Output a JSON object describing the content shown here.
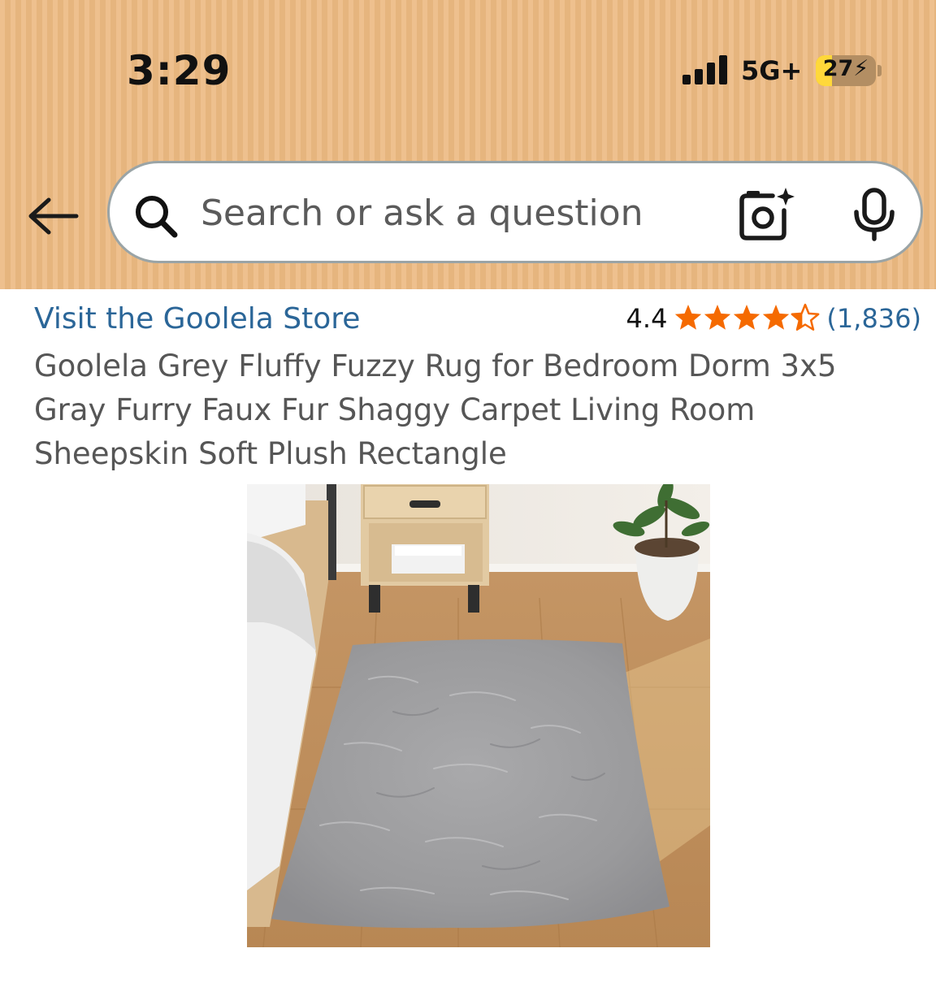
{
  "status_bar": {
    "time": "3:29",
    "network": "5G+",
    "battery_level": "27",
    "battery_fraction": 0.27,
    "signal_bars": 4
  },
  "header": {
    "background_color": "#ecb981",
    "back_icon": "arrow-left-icon",
    "search": {
      "placeholder": "Search or ask a question",
      "value": "",
      "left_icon": "search-icon",
      "camera_icon": "camera-sparkle-icon",
      "mic_icon": "microphone-icon"
    }
  },
  "product": {
    "store_link": "Visit the Goolela Store",
    "rating": {
      "value": "4.4",
      "stars": 4.4,
      "count": "(1,836)",
      "star_color": "#f56a00"
    },
    "title": "Goolela Grey Fluffy Fuzzy Rug for Bedroom Dorm 3x5 Gray Furry Faux Fur Shaggy Carpet Living Room Sheepskin Soft Plush Rectangle",
    "image": {
      "subject": "grey faux fur rectangular rug on wooden floor beside bed, nightstand and potted plant"
    }
  },
  "colors": {
    "link": "#2b6698",
    "title_text": "#565656",
    "search_border": "#9aa4a6"
  }
}
